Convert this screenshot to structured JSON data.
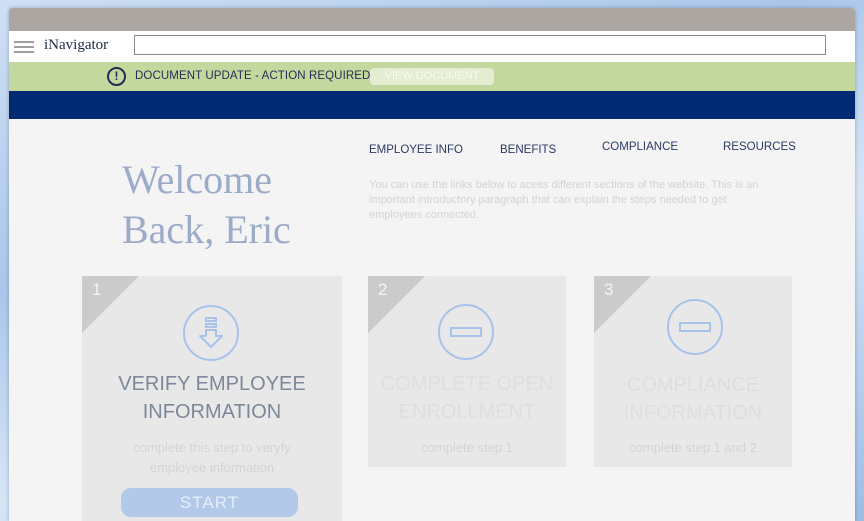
{
  "browser": {
    "logo": "iNavigator",
    "address_value": "",
    "address_placeholder": ""
  },
  "alert": {
    "message": "DOCUMENT UPDATE - ACTION REQUIRED",
    "button_label": "VIEW DOCUMENT",
    "icon": "exclamation-circle-icon"
  },
  "main": {
    "welcome_line1": "Welcome",
    "welcome_line2": "Back, Eric",
    "nav": [
      {
        "label": "EMPLOYEE INFO"
      },
      {
        "label": "BENEFITS"
      },
      {
        "label": "COMPLIANCE"
      },
      {
        "label": "RESOURCES"
      }
    ],
    "intro": "You can use the links below to acess different sections of the website. This is an important introductory  paragraph that can explain the steps needed to get employees connected."
  },
  "steps": [
    {
      "number": "1",
      "title_line1": "VERIFY EMPLOYEE",
      "title_line2": "INFORMATION",
      "subtitle_line1": "complete this step to veryfy",
      "subtitle_line2": "employee information",
      "button_label": "START",
      "icon": "download-arrow-icon"
    },
    {
      "number": "2",
      "title_line1": "COMPLETE OPEN",
      "title_line2": "ENROLLMENT",
      "subtitle_line1": "complete step 1",
      "icon": "minus-circle-icon"
    },
    {
      "number": "3",
      "title_line1": "COMPLIANCE",
      "title_line2": "INFORMATION",
      "subtitle_line1": "complete step 1 and 2",
      "icon": "minus-circle-icon"
    }
  ],
  "colors": {
    "navy": "#002a72",
    "alert_green": "#c4d89e",
    "accent_blue": "#a7c3ea",
    "welcome_text": "#9cabc8"
  }
}
